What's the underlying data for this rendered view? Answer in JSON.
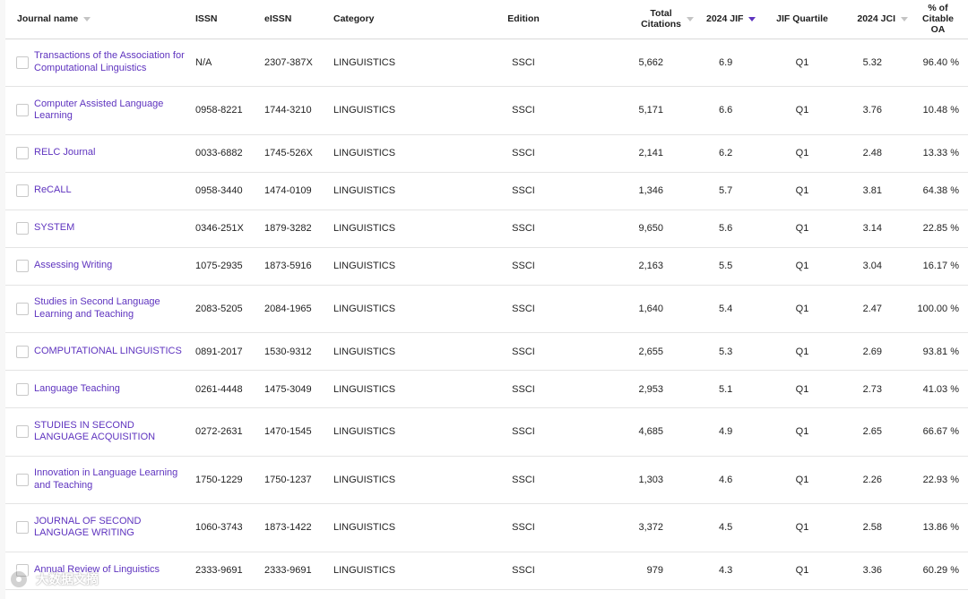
{
  "headers": {
    "journal_name": "Journal name",
    "issn": "ISSN",
    "eissn": "eISSN",
    "category": "Category",
    "edition": "Edition",
    "total_citations_1": "Total",
    "total_citations_2": "Citations",
    "jif": "2024 JIF",
    "jif_quartile": "JIF Quartile",
    "jci": "2024 JCI",
    "oa_1": "% of",
    "oa_2": "Citable",
    "oa_3": "OA"
  },
  "colors": {
    "link": "#5e33bf",
    "sort_active": "#5e33bf",
    "sort_inactive": "#c4c4c4"
  },
  "rows": [
    {
      "name": "Transactions of the Association for Computational Linguistics",
      "issn": "N/A",
      "eissn": "2307-387X",
      "category": "LINGUISTICS",
      "edition": "SSCI",
      "citations": "5,662",
      "jif": "6.9",
      "quartile": "Q1",
      "jci": "5.32",
      "oa": "96.40 %"
    },
    {
      "name": "Computer Assisted Language Learning",
      "issn": "0958-8221",
      "eissn": "1744-3210",
      "category": "LINGUISTICS",
      "edition": "SSCI",
      "citations": "5,171",
      "jif": "6.6",
      "quartile": "Q1",
      "jci": "3.76",
      "oa": "10.48 %"
    },
    {
      "name": "RELC Journal",
      "issn": "0033-6882",
      "eissn": "1745-526X",
      "category": "LINGUISTICS",
      "edition": "SSCI",
      "citations": "2,141",
      "jif": "6.2",
      "quartile": "Q1",
      "jci": "2.48",
      "oa": "13.33 %"
    },
    {
      "name": "ReCALL",
      "issn": "0958-3440",
      "eissn": "1474-0109",
      "category": "LINGUISTICS",
      "edition": "SSCI",
      "citations": "1,346",
      "jif": "5.7",
      "quartile": "Q1",
      "jci": "3.81",
      "oa": "64.38 %"
    },
    {
      "name": "SYSTEM",
      "issn": "0346-251X",
      "eissn": "1879-3282",
      "category": "LINGUISTICS",
      "edition": "SSCI",
      "citations": "9,650",
      "jif": "5.6",
      "quartile": "Q1",
      "jci": "3.14",
      "oa": "22.85 %"
    },
    {
      "name": "Assessing Writing",
      "issn": "1075-2935",
      "eissn": "1873-5916",
      "category": "LINGUISTICS",
      "edition": "SSCI",
      "citations": "2,163",
      "jif": "5.5",
      "quartile": "Q1",
      "jci": "3.04",
      "oa": "16.17 %"
    },
    {
      "name": "Studies in Second Language Learning and Teaching",
      "issn": "2083-5205",
      "eissn": "2084-1965",
      "category": "LINGUISTICS",
      "edition": "SSCI",
      "citations": "1,640",
      "jif": "5.4",
      "quartile": "Q1",
      "jci": "2.47",
      "oa": "100.00 %"
    },
    {
      "name": "COMPUTATIONAL LINGUISTICS",
      "issn": "0891-2017",
      "eissn": "1530-9312",
      "category": "LINGUISTICS",
      "edition": "SSCI",
      "citations": "2,655",
      "jif": "5.3",
      "quartile": "Q1",
      "jci": "2.69",
      "oa": "93.81 %"
    },
    {
      "name": "Language Teaching",
      "issn": "0261-4448",
      "eissn": "1475-3049",
      "category": "LINGUISTICS",
      "edition": "SSCI",
      "citations": "2,953",
      "jif": "5.1",
      "quartile": "Q1",
      "jci": "2.73",
      "oa": "41.03 %"
    },
    {
      "name": "STUDIES IN SECOND LANGUAGE ACQUISITION",
      "issn": "0272-2631",
      "eissn": "1470-1545",
      "category": "LINGUISTICS",
      "edition": "SSCI",
      "citations": "4,685",
      "jif": "4.9",
      "quartile": "Q1",
      "jci": "2.65",
      "oa": "66.67 %"
    },
    {
      "name": "Innovation in Language Learning and Teaching",
      "issn": "1750-1229",
      "eissn": "1750-1237",
      "category": "LINGUISTICS",
      "edition": "SSCI",
      "citations": "1,303",
      "jif": "4.6",
      "quartile": "Q1",
      "jci": "2.26",
      "oa": "22.93 %"
    },
    {
      "name": "JOURNAL OF SECOND LANGUAGE WRITING",
      "issn": "1060-3743",
      "eissn": "1873-1422",
      "category": "LINGUISTICS",
      "edition": "SSCI",
      "citations": "3,372",
      "jif": "4.5",
      "quartile": "Q1",
      "jci": "2.58",
      "oa": "13.86 %"
    },
    {
      "name": "Annual Review of Linguistics",
      "issn": "2333-9691",
      "eissn": "2333-9691",
      "category": "LINGUISTICS",
      "edition": "SSCI",
      "citations": "979",
      "jif": "4.3",
      "quartile": "Q1",
      "jci": "3.36",
      "oa": "60.29 %"
    }
  ],
  "watermark": "大数据文摘"
}
